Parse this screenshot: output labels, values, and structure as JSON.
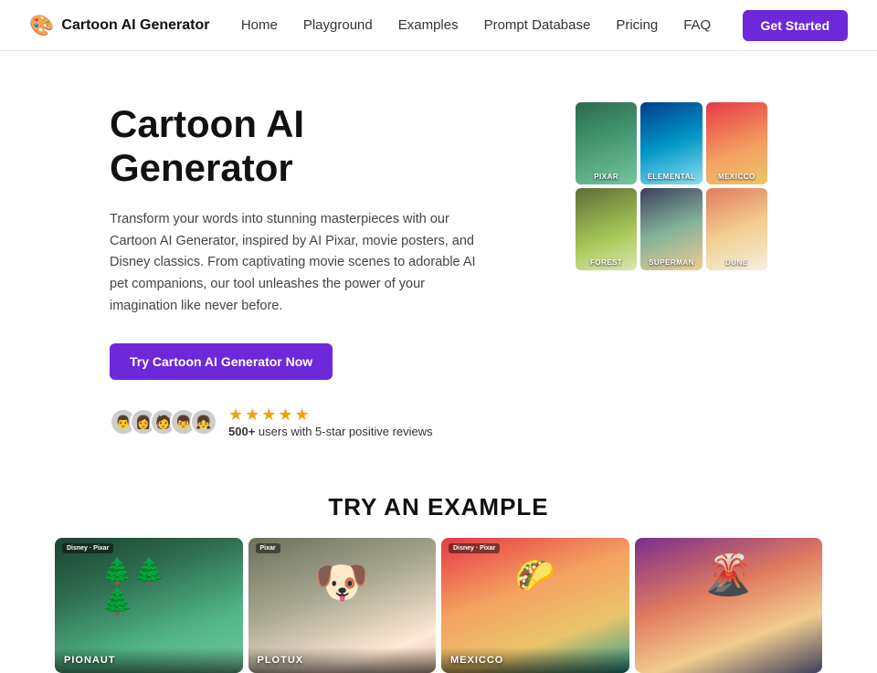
{
  "nav": {
    "logo_icon": "🎨",
    "logo_text": "Cartoon AI Generator",
    "links": [
      {
        "label": "Home",
        "id": "home"
      },
      {
        "label": "Playground",
        "id": "playground"
      },
      {
        "label": "Examples",
        "id": "examples"
      },
      {
        "label": "Prompt Database",
        "id": "prompt-database"
      },
      {
        "label": "Pricing",
        "id": "pricing"
      },
      {
        "label": "FAQ",
        "id": "faq"
      }
    ],
    "cta_label": "Get Started"
  },
  "hero": {
    "title": "Cartoon AI Generator",
    "description": "Transform your words into stunning masterpieces with our Cartoon AI Generator, inspired by AI Pixar, movie posters, and Disney classics. From captivating movie scenes to adorable AI pet companions, our tool unleashes the power of your imagination like never before.",
    "cta_label": "Try Cartoon AI Generator Now",
    "review_count": "500+",
    "review_text": "users with 5-star positive reviews",
    "grid_images": [
      {
        "label": "Pixar",
        "class": "gi-1"
      },
      {
        "label": "Elemental",
        "class": "gi-2"
      },
      {
        "label": "Mexicco",
        "class": "gi-3"
      },
      {
        "label": "Forest",
        "class": "gi-4"
      },
      {
        "label": "Superman",
        "class": "gi-5"
      },
      {
        "label": "Dune",
        "class": "gi-6"
      }
    ]
  },
  "try_section": {
    "title": "TRY AN EXAMPLE",
    "examples": [
      {
        "title": "PIONAUT",
        "subtitle": "Disney · Pixar",
        "class": "ec-1"
      },
      {
        "title": "PLOTUX",
        "subtitle": "Pixar",
        "class": "ec-2"
      },
      {
        "title": "MEXICCO",
        "subtitle": "Disney · Pixar",
        "class": "ec-3"
      },
      {
        "title": "",
        "subtitle": "",
        "class": "ec-4"
      }
    ]
  },
  "avatars": [
    "👨",
    "👩",
    "🧑",
    "👦",
    "👧"
  ]
}
